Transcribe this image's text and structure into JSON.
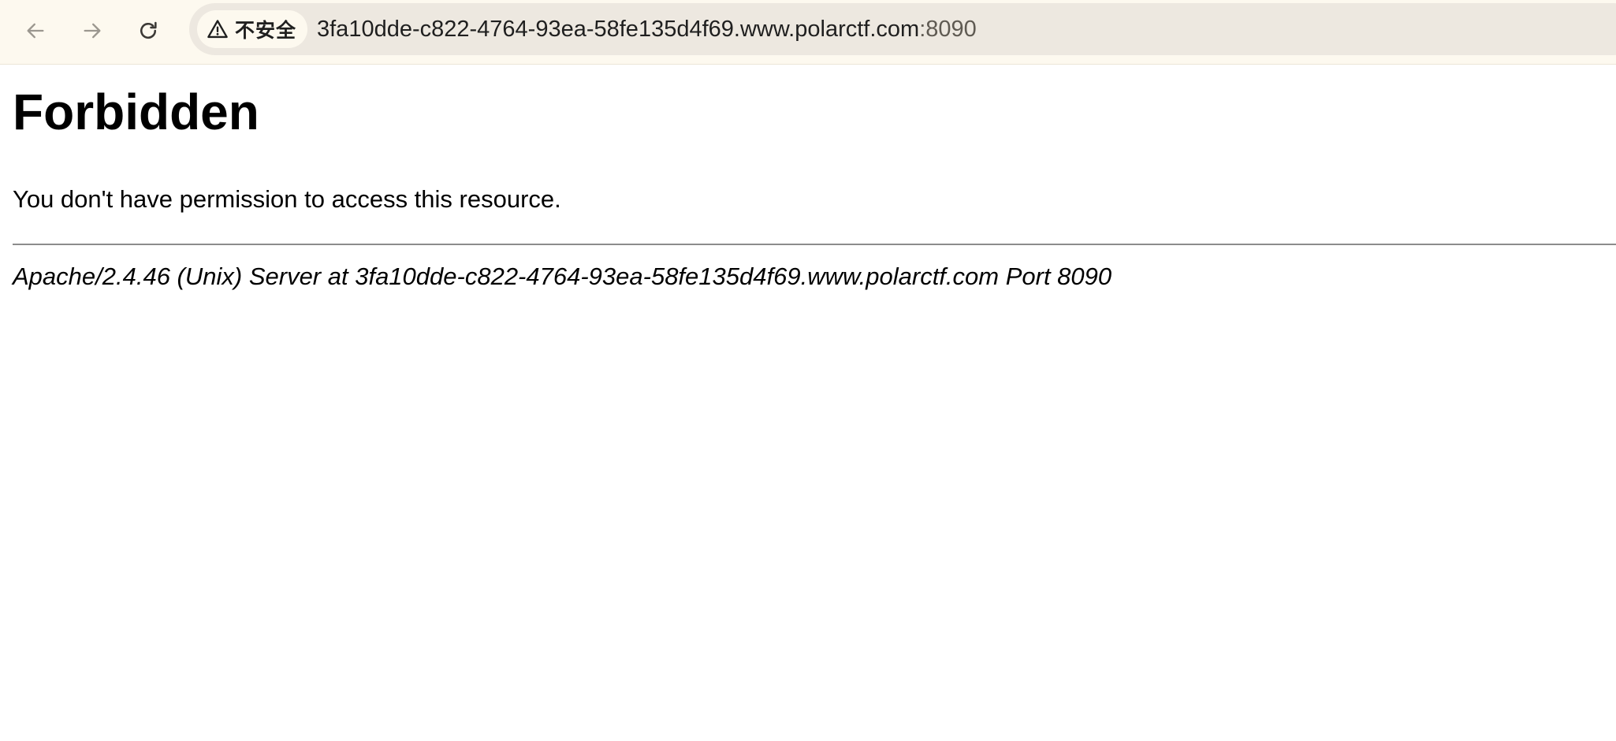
{
  "browser": {
    "security_label": "不安全",
    "url_host": "3fa10dde-c822-4764-93ea-58fe135d4f69.www.polarctf.com",
    "url_port": ":8090",
    "icons": {
      "back": "arrow-left-icon",
      "forward": "arrow-right-icon",
      "reload": "reload-icon",
      "security": "warning-triangle-icon"
    }
  },
  "page": {
    "heading": "Forbidden",
    "message": "You don't have permission to access this resource.",
    "server_signature": "Apache/2.4.46 (Unix) Server at 3fa10dde-c822-4764-93ea-58fe135d4f69.www.polarctf.com Port 8090"
  },
  "colors": {
    "toolbar_bg": "#fdf9ef",
    "omnibox_bg": "#ede8e0",
    "nav_disabled": "#9b978f",
    "nav_enabled": "#3c3a36"
  }
}
